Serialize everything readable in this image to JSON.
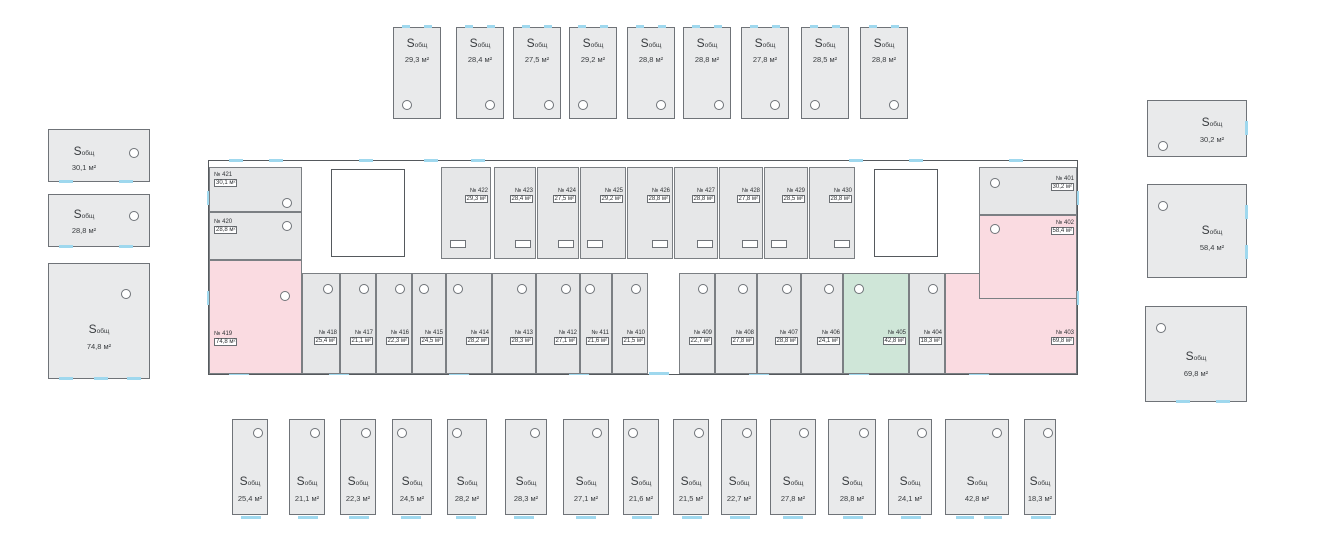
{
  "label_s": "S",
  "label_sub": "общ",
  "top_cards": [
    {
      "area": "29,3 м²"
    },
    {
      "area": "28,4 м²"
    },
    {
      "area": "27,5 м²"
    },
    {
      "area": "29,2 м²"
    },
    {
      "area": "28,8 м²"
    },
    {
      "area": "28,8 м²"
    },
    {
      "area": "27,8 м²"
    },
    {
      "area": "28,5 м²"
    },
    {
      "area": "28,8 м²"
    }
  ],
  "left_cards": [
    {
      "area": "30,1 м²"
    },
    {
      "area": "28,8 м²"
    },
    {
      "area": "74,8 м²"
    }
  ],
  "right_cards": [
    {
      "area": "30,2 м²"
    },
    {
      "area": "58,4 м²"
    },
    {
      "area": "69,8 м²"
    }
  ],
  "bottom_cards": [
    {
      "area": "25,4 м²"
    },
    {
      "area": "21,1 м²"
    },
    {
      "area": "22,3 м²"
    },
    {
      "area": "24,5 м²"
    },
    {
      "area": "28,2 м²"
    },
    {
      "area": "28,3 м²"
    },
    {
      "area": "27,1 м²"
    },
    {
      "area": "21,6 м²"
    },
    {
      "area": "21,5 м²"
    },
    {
      "area": "22,7 м²"
    },
    {
      "area": "27,8 м²"
    },
    {
      "area": "28,8 м²"
    },
    {
      "area": "24,1 м²"
    },
    {
      "area": "42,8 м²"
    },
    {
      "area": "18,3 м²"
    }
  ],
  "plan": {
    "apartments": [
      {
        "no": "№ 421",
        "area": "30,1 м²",
        "status": "available"
      },
      {
        "no": "№ 420",
        "area": "28,8 м²",
        "status": "available"
      },
      {
        "no": "№ 419",
        "area": "74,8 м²",
        "status": "highlighted"
      },
      {
        "no": "№ 418",
        "area": "25,4 м²",
        "status": "available"
      },
      {
        "no": "№ 417",
        "area": "21,1 м²",
        "status": "available"
      },
      {
        "no": "№ 416",
        "area": "22,3 м²",
        "status": "available"
      },
      {
        "no": "№ 415",
        "area": "24,5 м²",
        "status": "available"
      },
      {
        "no": "№ 414",
        "area": "28,2 м²",
        "status": "available"
      },
      {
        "no": "№ 413",
        "area": "28,3 м²",
        "status": "available"
      },
      {
        "no": "№ 412",
        "area": "27,1 м²",
        "status": "available"
      },
      {
        "no": "№ 411",
        "area": "21,6 м²",
        "status": "available"
      },
      {
        "no": "№ 410",
        "area": "21,5 м²",
        "status": "available"
      },
      {
        "no": "№ 409",
        "area": "22,7 м²",
        "status": "available"
      },
      {
        "no": "№ 408",
        "area": "27,8 м²",
        "status": "available"
      },
      {
        "no": "№ 407",
        "area": "28,8 м²",
        "status": "available"
      },
      {
        "no": "№ 406",
        "area": "24,1 м²",
        "status": "available"
      },
      {
        "no": "№ 405",
        "area": "42,8 м²",
        "status": "selected"
      },
      {
        "no": "№ 404",
        "area": "18,3 м²",
        "status": "available"
      },
      {
        "no": "№ 403",
        "area": "69,8 м²",
        "status": "highlighted"
      },
      {
        "no": "№ 402",
        "area": "58,4 м²",
        "status": "highlighted"
      },
      {
        "no": "№ 401",
        "area": "30,2 м²",
        "status": "available"
      },
      {
        "no": "№ 422",
        "area": "29,3 м²",
        "status": "available"
      },
      {
        "no": "№ 423",
        "area": "28,4 м²",
        "status": "available"
      },
      {
        "no": "№ 424",
        "area": "27,5 м²",
        "status": "available"
      },
      {
        "no": "№ 425",
        "area": "29,2 м²",
        "status": "available"
      },
      {
        "no": "№ 426",
        "area": "28,8 м²",
        "status": "available"
      },
      {
        "no": "№ 427",
        "area": "28,8 м²",
        "status": "available"
      },
      {
        "no": "№ 428",
        "area": "27,8 м²",
        "status": "available"
      },
      {
        "no": "№ 429",
        "area": "28,5 м²",
        "status": "available"
      },
      {
        "no": "№ 430",
        "area": "28,8 м²",
        "status": "available"
      }
    ]
  },
  "colors": {
    "room": "#e6e7e8",
    "highlighted": "#fadbe1",
    "selected": "#cfe6d8",
    "window": "#9fd8ee",
    "wall": "#55595d"
  }
}
